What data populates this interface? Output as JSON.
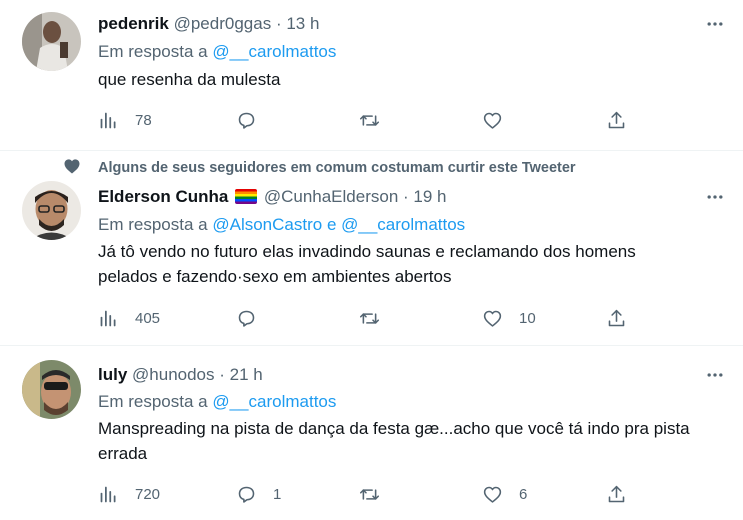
{
  "tweets": [
    {
      "name": "pedenrik",
      "handle": "@pedr0ggas",
      "sep": "·",
      "time": "13 h",
      "reply_prefix": "Em resposta a",
      "reply_mentions": [
        "@__carolmattos"
      ],
      "reply_joiner": "",
      "text": "que resenha da mulesta",
      "views": "78",
      "replies": "",
      "retweets": "",
      "likes": ""
    },
    {
      "social_context": "Alguns de seus seguidores em comum costumam curtir este Tweeter",
      "name": "Elderson Cunha",
      "handle": "@CunhaElderson",
      "sep": "·",
      "time": "19 h",
      "reply_prefix": "Em resposta a",
      "reply_mentions": [
        "@AlsonCastro",
        "@__carolmattos"
      ],
      "reply_joiner": "e",
      "text": "Já tô vendo no futuro elas invadindo saunas e reclamando dos homens pelados e fazendo·sexo em ambientes abertos",
      "views": "405",
      "replies": "",
      "retweets": "",
      "likes": "10"
    },
    {
      "name": "luly",
      "handle": "@hunodos",
      "sep": "·",
      "time": "21 h",
      "reply_prefix": "Em resposta a",
      "reply_mentions": [
        "@__carolmattos"
      ],
      "reply_joiner": "",
      "text": "Manspreading na pista de dança da festa gæ...acho que você tá indo pra pista errada",
      "views": "720",
      "replies": "1",
      "retweets": "",
      "likes": "6"
    }
  ],
  "icons": {
    "more": "more-horizontal-icon",
    "views": "views-bar-chart-icon",
    "reply": "reply-bubble-icon",
    "retweet": "retweet-icon",
    "like": "heart-icon",
    "share": "share-upload-icon",
    "social": "heart-filled-icon",
    "flag": "rainbow-flag-icon"
  },
  "colors": {
    "text": "#0f1419",
    "secondary": "#536471",
    "link": "#1d9bf0",
    "divider": "#eff3f4"
  }
}
